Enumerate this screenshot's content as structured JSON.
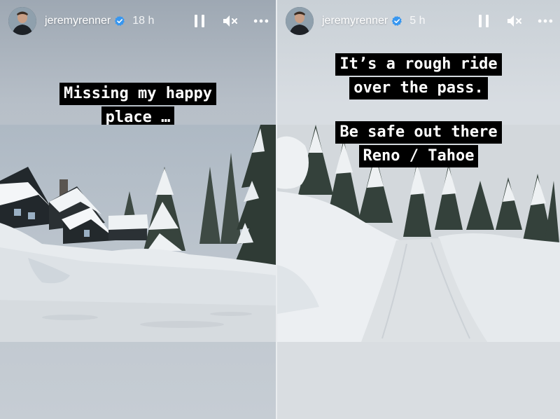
{
  "stories": [
    {
      "username": "jeremyrenner",
      "time": "18 h",
      "caption_lines": [
        "Missing my happy",
        "place …"
      ],
      "icons": {
        "verified": "verified-badge-icon",
        "pause": "pause-icon",
        "mute": "muted-speaker-icon",
        "more": "more-options-icon"
      }
    },
    {
      "username": "jeremyrenner",
      "time": "5 h",
      "caption_lines": [
        "It’s a rough ride",
        "over the pass.",
        "Be safe out there",
        "Reno / Tahoe"
      ],
      "icons": {
        "verified": "verified-badge-icon",
        "pause": "pause-icon",
        "mute": "muted-speaker-icon",
        "more": "more-options-icon"
      }
    }
  ],
  "colors": {
    "verified": "#3897f0",
    "caption_bg": "#000000",
    "caption_text": "#ffffff"
  }
}
